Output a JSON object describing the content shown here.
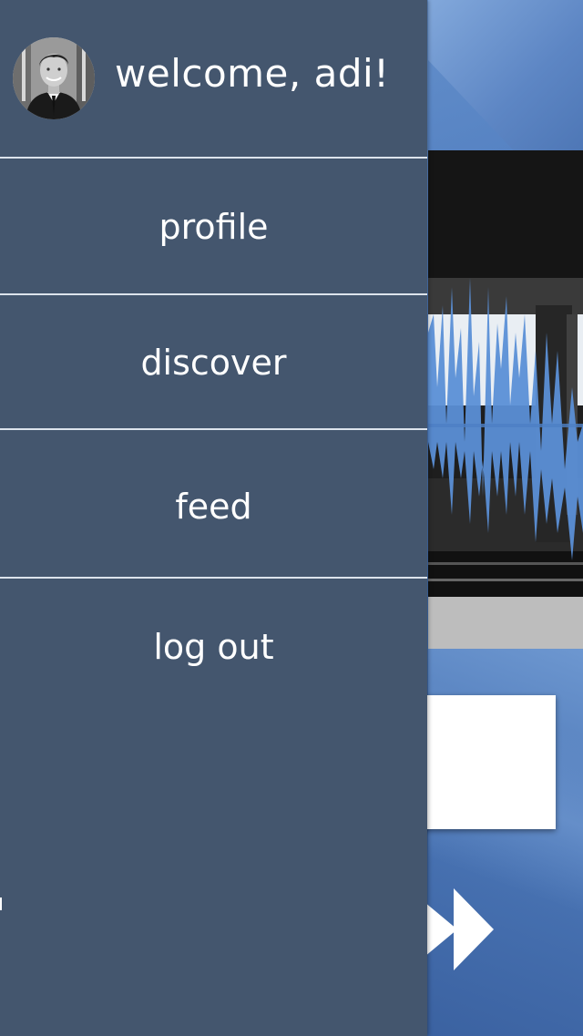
{
  "drawer": {
    "welcome_text": "welcome, adi!",
    "menu": [
      {
        "label": "profile"
      },
      {
        "label": "discover"
      },
      {
        "label": "feed"
      },
      {
        "label": "log out"
      }
    ]
  },
  "colors": {
    "drawer_bg": "#44566e",
    "accent_blue": "#5b8fd6",
    "background_blue": "#3f659e",
    "text": "#ffffff"
  },
  "icons": {
    "avatar": "user-avatar",
    "behind_drawer": [
      "fast-forward-icon"
    ]
  }
}
